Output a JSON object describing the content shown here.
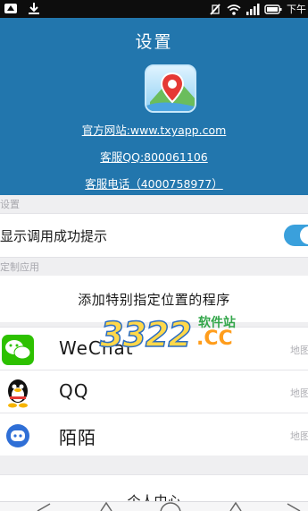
{
  "status_bar": {
    "time": "下午",
    "icons": [
      "notification-icon",
      "download-icon",
      "no-sim-icon",
      "wifi-icon",
      "signal-icon",
      "battery-icon"
    ]
  },
  "header": {
    "title": "设置",
    "app_icon": "map-pin-app-icon",
    "website": "官方网站:www.txyapp.com",
    "qq_support": "客服QQ:800061106",
    "phone_support": "客服电话（4000758977）"
  },
  "sections": {
    "settings_label": "设置",
    "custom_apps_label": "定制应用"
  },
  "toggle_row": {
    "label": "显示调用成功提示",
    "state": "on"
  },
  "add_program_label": "添加特别指定位置的程序",
  "apps": [
    {
      "name": "WeChat",
      "tag": "地图",
      "icon": "wechat-icon"
    },
    {
      "name": "QQ",
      "tag": "地图",
      "icon": "qq-penguin-icon"
    },
    {
      "name": "陌陌",
      "tag": "地图",
      "icon": "momo-icon"
    }
  ],
  "bottom_action": "个人中心",
  "watermark": {
    "number": "3322",
    "soft": "软件站",
    "cc": ".CC"
  },
  "colors": {
    "header_bg": "#2276ad",
    "accent": "#3aa0dc",
    "page_bg": "#efeff1"
  }
}
